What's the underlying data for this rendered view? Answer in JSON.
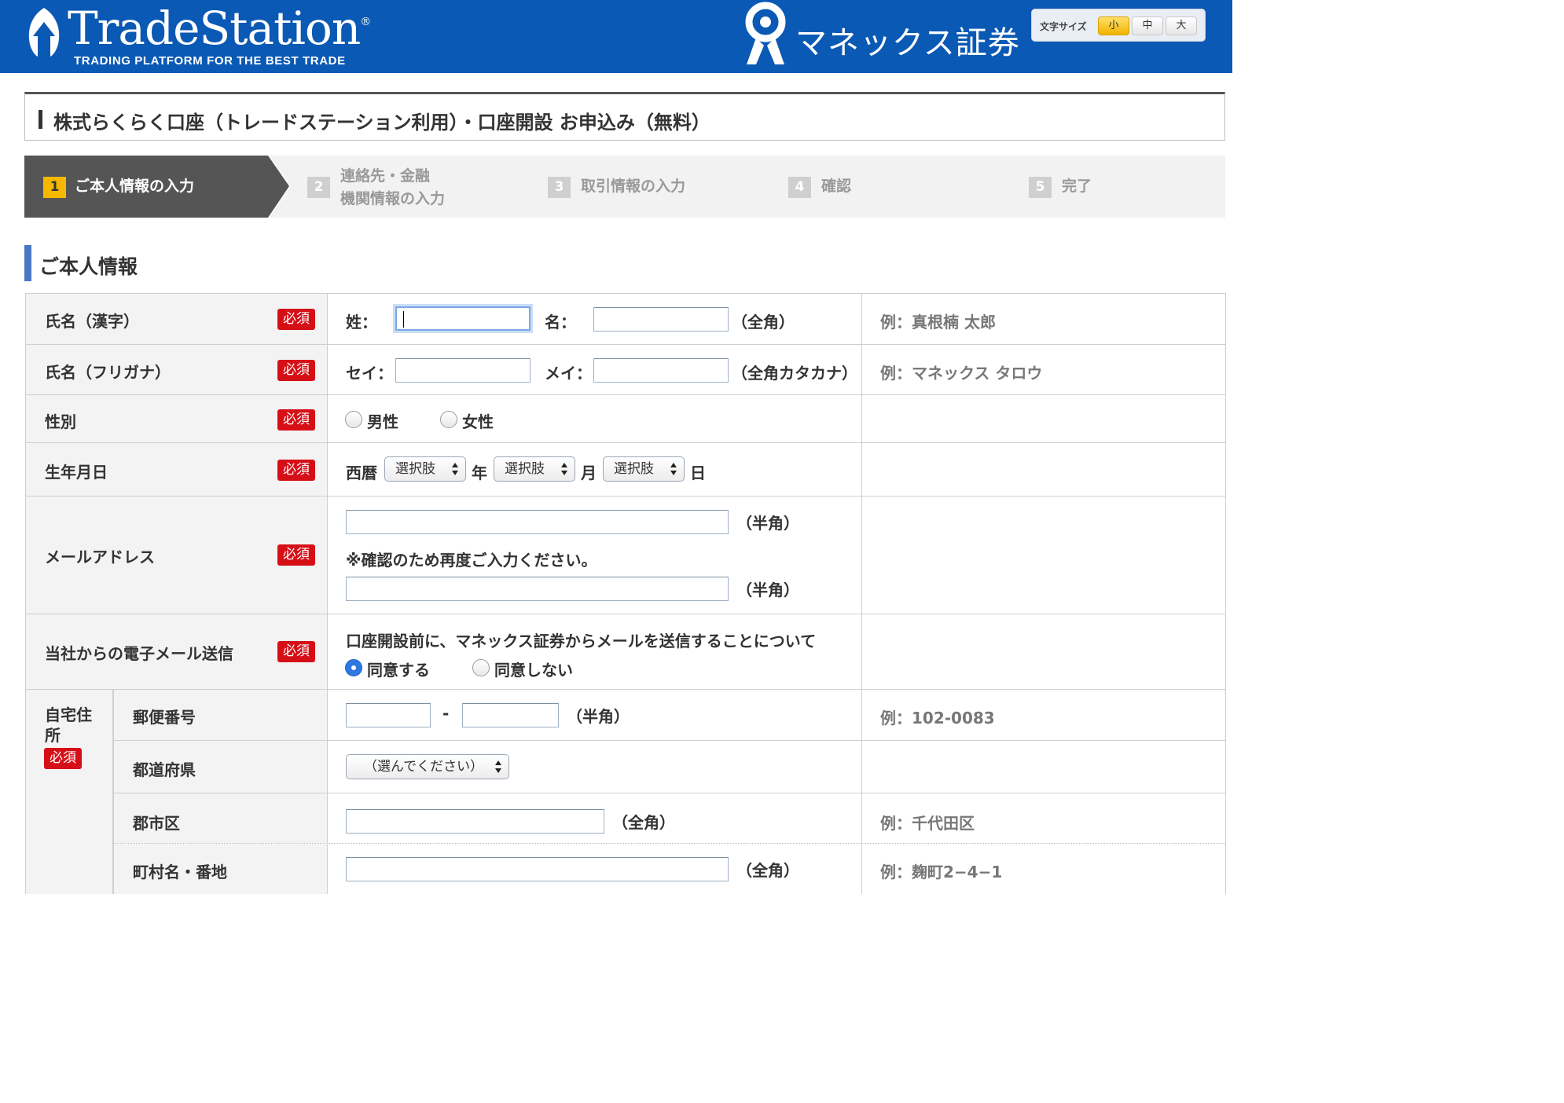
{
  "header": {
    "brand_name": "TradeStation",
    "brand_reg": "®",
    "brand_tagline": "TRADING PLATFORM FOR THE BEST TRADE",
    "partner_name": "マネックス証券",
    "font_size_label": "文字サイズ",
    "font_sizes": [
      "小",
      "中",
      "大"
    ],
    "font_size_selected": "小"
  },
  "page_title": "株式らくらく口座（トレードステーション利用）・口座開設 お申込み（無料）",
  "steps": [
    {
      "number": "1",
      "label": "ご本人情報の入力",
      "active": true
    },
    {
      "number": "2",
      "label_line1": "連絡先・金融",
      "label_line2": "機関情報の入力",
      "active": false
    },
    {
      "number": "3",
      "label": "取引情報の入力",
      "active": false
    },
    {
      "number": "4",
      "label": "確認",
      "active": false
    },
    {
      "number": "5",
      "label": "完了",
      "active": false
    }
  ],
  "section_heading": "ご本人情報",
  "required_badge": "必須",
  "form": {
    "name_kanji": {
      "label": "氏名（漢字）",
      "sei_label": "姓：",
      "mei_label": "名：",
      "note": "（全角）",
      "example": "例：真根楠 太郎",
      "sei_value": "",
      "mei_value": ""
    },
    "name_kana": {
      "label": "氏名（フリガナ）",
      "sei_label": "セイ：",
      "mei_label": "メイ：",
      "note": "（全角カタカナ）",
      "example": "例：マネックス タロウ",
      "sei_value": "",
      "mei_value": ""
    },
    "gender": {
      "label": "性別",
      "options": [
        "男性",
        "女性"
      ],
      "selected": null
    },
    "birthdate": {
      "label": "生年月日",
      "era_label": "西暦",
      "year_select": "選択肢",
      "year_suffix": "年",
      "month_select": "選択肢",
      "month_suffix": "月",
      "day_select": "選択肢",
      "day_suffix": "日"
    },
    "email": {
      "label": "メールアドレス",
      "note": "（半角）",
      "confirm_note": "※確認のため再度ご入力ください。",
      "value": "",
      "confirm_value": ""
    },
    "email_consent": {
      "label": "当社からの電子メール送信",
      "question": "口座開設前に、マネックス証券からメールを送信することについて",
      "options": [
        "同意する",
        "同意しない"
      ],
      "selected": "同意する"
    },
    "address": {
      "label_line1": "自宅住",
      "label_line2": "所",
      "postal": {
        "label": "郵便番号",
        "separator": "-",
        "note": "（半角）",
        "example": "例：102-0083"
      },
      "prefecture": {
        "label": "都道府県",
        "select_value": "（選んでください）"
      },
      "city": {
        "label": "郡市区",
        "note": "（全角）",
        "example": "例：千代田区"
      },
      "town": {
        "label": "町村名・番地",
        "note": "（全角）",
        "example": "例：麹町2−4−1"
      }
    }
  },
  "colors": {
    "header_bg": "#0a59b4",
    "accent_blue": "#4a78c4",
    "required_red": "#d60f17",
    "active_step": "#555555",
    "step_number_active": "#f6b800"
  }
}
